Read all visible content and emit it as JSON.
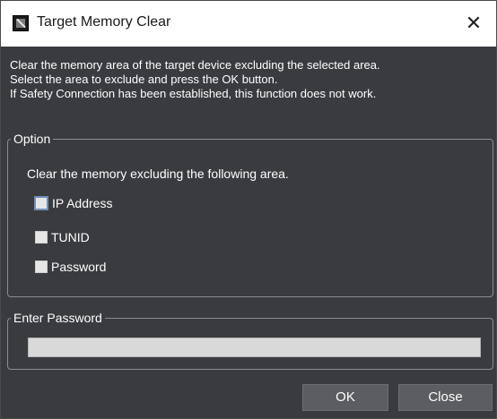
{
  "window": {
    "title": "Target Memory Clear",
    "icon": "app-icon",
    "close_glyph": "✕"
  },
  "description": {
    "lines": [
      "Clear the memory area of the target device excluding the selected area.",
      "Select the area to exclude and press the OK button.",
      "If Safety Connection has been established, this function does not work."
    ]
  },
  "option": {
    "legend": "Option",
    "instruction": "Clear the memory excluding the following area.",
    "items": [
      {
        "label": "IP Address",
        "checked": false
      },
      {
        "label": "TUNID",
        "checked": false
      },
      {
        "label": "Password",
        "checked": false
      }
    ]
  },
  "password": {
    "legend": "Enter Password",
    "value": ""
  },
  "buttons": {
    "ok": "OK",
    "close": "Close"
  },
  "colors": {
    "background": "#393b3f",
    "titlebar": "#ffffff",
    "button": "#5c5d61"
  }
}
